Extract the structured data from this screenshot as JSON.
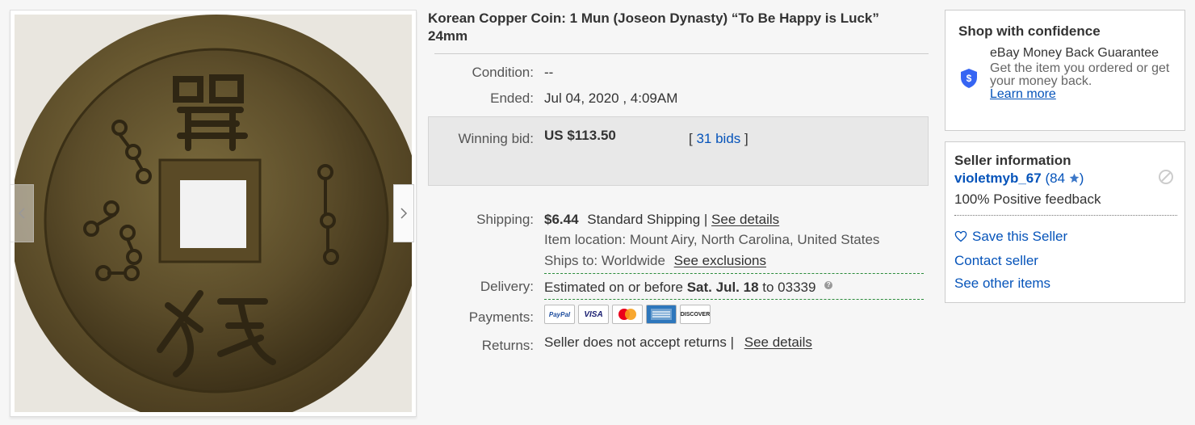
{
  "listing": {
    "title": "Korean Copper Coin: 1 Mun (Joseon Dynasty) “To Be Happy is Luck” 24mm",
    "condition_label": "Condition:",
    "condition_value": "--",
    "ended_label": "Ended:",
    "ended_value": "Jul 04, 2020 , 4:09AM",
    "winning_bid_label": "Winning bid:",
    "winning_bid_value": "US $113.50",
    "bids_open": "[",
    "bids_link": "31 bids",
    "bids_close": "]"
  },
  "shipping": {
    "label": "Shipping:",
    "cost": "$6.44",
    "method": "Standard Shipping |",
    "details_link": "See details",
    "location": "Item location: Mount Airy, North Carolina, United States",
    "ships_to": "Ships to: Worldwide",
    "exclusions_link": "See exclusions"
  },
  "delivery": {
    "label": "Delivery:",
    "prefix": "Estimated on or before",
    "date": "Sat. Jul. 18",
    "suffix": "to 03339"
  },
  "payments": {
    "label": "Payments:",
    "methods": [
      "PayPal",
      "VISA",
      "Mastercard",
      "American Express",
      "DISCOVER"
    ]
  },
  "returns": {
    "label": "Returns:",
    "text": "Seller does not accept returns |",
    "details_link": "See details"
  },
  "confidence": {
    "heading": "Shop with confidence",
    "guarantee_title": "eBay Money Back Guarantee",
    "guarantee_text": "Get the item you ordered or get your money back.",
    "learn_more": "Learn more",
    "shield_symbol": "$"
  },
  "seller": {
    "heading": "Seller information",
    "name": "violetmyb_67",
    "score": "84",
    "score_open": "(",
    "score_close": ")",
    "feedback": "100% Positive feedback",
    "save_link": "Save this Seller",
    "contact_link": "Contact seller",
    "other_items_link": "See other items"
  },
  "icons": {
    "prev": "chevron-left-icon",
    "next": "chevron-right-icon",
    "shield": "shield-dollar-icon",
    "star": "star-icon",
    "heart": "heart-icon",
    "help": "question-icon",
    "block": "block-icon"
  },
  "colors": {
    "link": "#0654ba",
    "dashed_rule": "#2a8b3a",
    "bid_box": "#e8e8e8"
  }
}
